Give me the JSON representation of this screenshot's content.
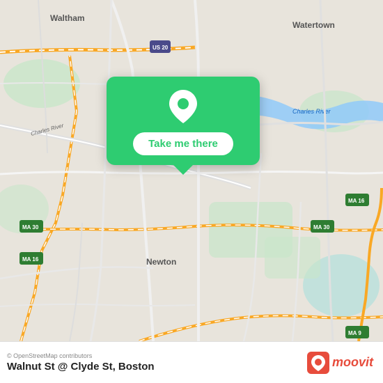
{
  "map": {
    "attribution": "© OpenStreetMap contributors",
    "background_color": "#e8e4dc"
  },
  "popup": {
    "button_label": "Take me there",
    "icon_name": "location-pin-icon"
  },
  "bottom_bar": {
    "location_name": "Walnut St @ Clyde St, Boston",
    "attribution": "© OpenStreetMap contributors",
    "moovit_label": "moovit"
  }
}
